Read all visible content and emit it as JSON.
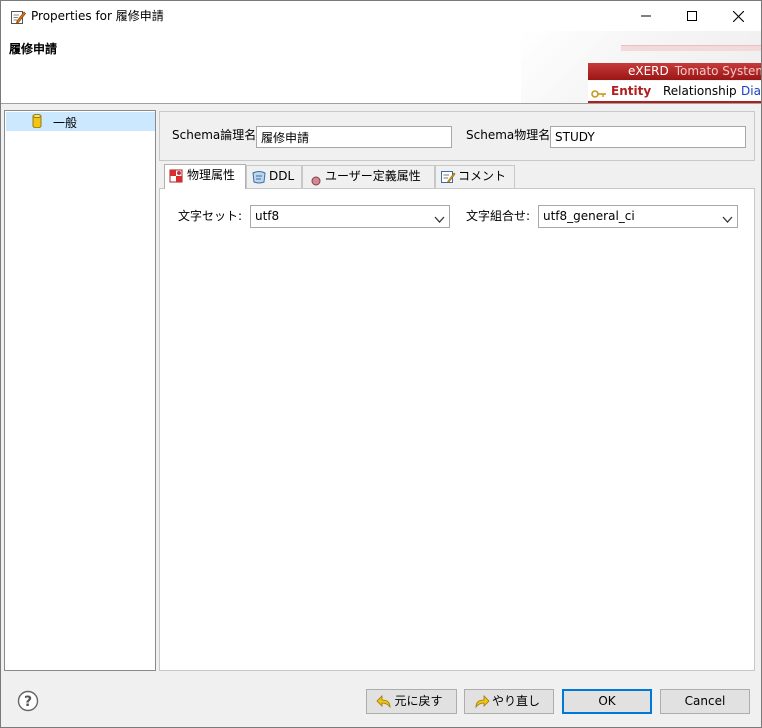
{
  "window": {
    "title": "Properties for 履修申請",
    "icons": {
      "app": "edit-properties-icon",
      "minimize": "minimize-icon",
      "maximize": "maximize-icon",
      "close": "close-icon"
    }
  },
  "header": {
    "title": "履修申請",
    "banner": {
      "brand": "eXERD",
      "product": "Tomato System",
      "tabs": [
        "Entity",
        "Relationship",
        "Diag"
      ]
    }
  },
  "tree": {
    "items": [
      {
        "label": "一般",
        "icon": "database-icon",
        "selected": true
      }
    ]
  },
  "schema": {
    "logical_label": "Schema論理名",
    "logical_value": "履修申請",
    "physical_label": "Schema物理名",
    "physical_value": "STUDY"
  },
  "tabs": [
    {
      "label": "物理属性",
      "icon": "physical-attr-icon",
      "active": true
    },
    {
      "label": "DDL",
      "icon": "ddl-icon",
      "active": false
    },
    {
      "label": "ユーザー定義属性",
      "icon": "user-attr-icon",
      "active": false
    },
    {
      "label": "コメント",
      "icon": "comment-icon",
      "active": false
    }
  ],
  "physical": {
    "charset_label": "文字セット:",
    "charset_value": "utf8",
    "collation_label": "文字組合せ:",
    "collation_value": "utf8_general_ci"
  },
  "footer": {
    "undo_label": "元に戻す",
    "redo_label": "やり直し",
    "ok_label": "OK",
    "cancel_label": "Cancel"
  },
  "colors": {
    "accent": "#0078d7",
    "brand": "#b01e1e",
    "selection": "#cce8ff",
    "link": "#1a3fc4"
  }
}
